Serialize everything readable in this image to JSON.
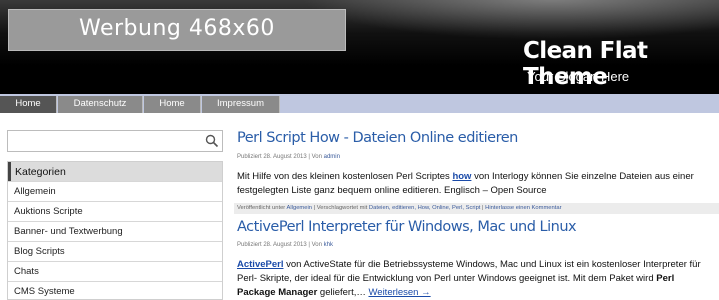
{
  "header": {
    "ad_label": "Werbung 468x60",
    "site_title": "Clean Flat Theme",
    "slogan": "Your Slogan Here"
  },
  "nav": {
    "items": [
      "Home",
      "Datenschutz",
      "Home",
      "Impressum"
    ]
  },
  "sidebar": {
    "search": {
      "value": "",
      "placeholder": ""
    },
    "categories_heading": "Kategorien",
    "categories": [
      "Allgemein",
      "Auktions Scripte",
      "Banner- und Textwerbung",
      "Blog Scripts",
      "Chats",
      "CMS Systeme"
    ]
  },
  "posts": [
    {
      "title": "Perl Script How - Dateien Online editieren",
      "meta_prefix": "Publiziert 28. August 2013 | Von ",
      "author": "admin",
      "body": {
        "t1": "Mit Hilfe von des kleinen kostenlosen Perl Scriptes ",
        "link": "how",
        "t2": " von Interlogy können Sie einzelne Dateien aus einer festgelegten Liste ganz bequem online editieren. Englisch – Open Source"
      },
      "footer": {
        "prefix": "Veröffentlicht unter ",
        "category": "Allgemein",
        "tags_prefix": " | Verschlagwortet mit ",
        "tags": "Dateien, editieren, How, Online, Perl, Script",
        "sep": " | ",
        "comment": "Hinterlasse einen Kommentar"
      }
    },
    {
      "title": "ActivePerl Interpreter für Windows, Mac und Linux",
      "meta_prefix": "Publiziert 28. August 2013 | Von ",
      "author": "khk",
      "body": {
        "link": "ActivePerl",
        "t1": " von ActiveState für die Betriebssysteme Windows, Mac und Linux ist ein kostenloser Interpreter für Perl- Skripte, der ideal für die Entwicklung von Perl unter Windows geeignet ist. Mit dem Paket wird ",
        "bold": "Perl Package Manager",
        "t2": " geliefert,… ",
        "more": "Weiterlesen →"
      }
    }
  ]
}
